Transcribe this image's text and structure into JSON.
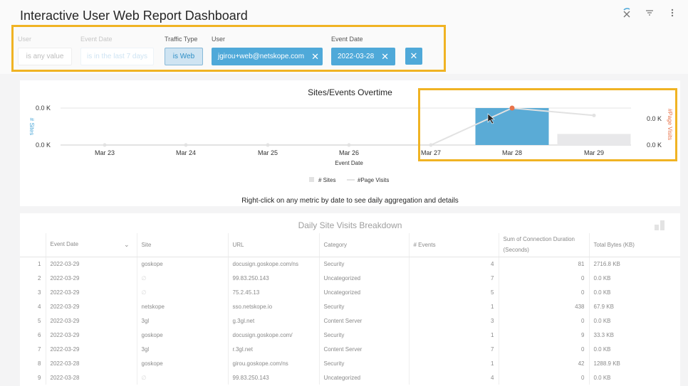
{
  "page": {
    "title": "Interactive User Web Report Dashboard"
  },
  "header_icons": [
    "loading-close-icon",
    "filter-icon",
    "more-vert-icon"
  ],
  "filters": [
    {
      "label": "User",
      "value": "is any value"
    },
    {
      "label": "Event Date",
      "value": "is in the last 7 days"
    },
    {
      "label": "Traffic Type",
      "value": "is Web"
    },
    {
      "label": "User",
      "value": "jgirou+web@netskope.com"
    },
    {
      "label": "Event Date",
      "value": "2022-03-28"
    }
  ],
  "chart": {
    "title": "Sites/Events Overtime",
    "hint": "Right-click on  any metric by date to see daily aggregation and details"
  },
  "chart_data": {
    "type": "bar",
    "title": "Sites/Events Overtime",
    "xlabel": "Event Date",
    "ylabel_left": "# Sites",
    "ylabel_right": "#Page Visits",
    "categories": [
      "Mar 23",
      "Mar 24",
      "Mar 25",
      "Mar 26",
      "Mar 27",
      "Mar 28",
      "Mar 29"
    ],
    "left_ticks": [
      "0.0 K",
      "0.0 K"
    ],
    "right_ticks": [
      "0.0 K",
      "0.0 K"
    ],
    "series": [
      {
        "name": "# Sites",
        "type": "bar",
        "values": [
          0,
          0,
          0,
          0,
          0,
          1.0,
          0.3
        ],
        "colors": [
          "#5aabd6",
          "#5aabd6",
          "#5aabd6",
          "#5aabd6",
          "#5aabd6",
          "#5aabd6",
          "#e8e8ea"
        ]
      },
      {
        "name": "#Page Visits",
        "type": "line",
        "values": [
          0,
          0,
          0,
          0,
          0,
          1.0,
          0.8
        ]
      }
    ],
    "legend": {
      "placement": "bottom"
    }
  },
  "table": {
    "title": "Daily Site Visits Breakdown",
    "columns": [
      "Event Date",
      "Site",
      "URL",
      "Category",
      "# Events",
      "Sum of Connection Duration (Seconds)",
      "Total Bytes (KB)"
    ],
    "rows": [
      {
        "idx": "1",
        "date": "2022-03-29",
        "site": "goskope",
        "url": "docusign.goskope.com/ns",
        "category": "Security",
        "events": "4",
        "duration": "81",
        "bytes": "2716.8 KB"
      },
      {
        "idx": "2",
        "date": "2022-03-29",
        "site": "∅",
        "url": "99.83.250.143",
        "category": "Uncategorized",
        "events": "7",
        "duration": "0",
        "bytes": "0.0 KB"
      },
      {
        "idx": "3",
        "date": "2022-03-29",
        "site": "∅",
        "url": "75.2.45.13",
        "category": "Uncategorized",
        "events": "5",
        "duration": "0",
        "bytes": "0.0 KB"
      },
      {
        "idx": "4",
        "date": "2022-03-29",
        "site": "netskope",
        "url": "sso.netskope.io",
        "category": "Security",
        "events": "1",
        "duration": "438",
        "bytes": "67.9 KB"
      },
      {
        "idx": "5",
        "date": "2022-03-29",
        "site": "3gl",
        "url": "g.3gl.net",
        "category": "Content Server",
        "events": "3",
        "duration": "0",
        "bytes": "0.0 KB"
      },
      {
        "idx": "6",
        "date": "2022-03-29",
        "site": "goskope",
        "url": "docusign.goskope.com/",
        "category": "Security",
        "events": "1",
        "duration": "9",
        "bytes": "33.3 KB"
      },
      {
        "idx": "7",
        "date": "2022-03-29",
        "site": "3gl",
        "url": "r.3gl.net",
        "category": "Content Server",
        "events": "7",
        "duration": "0",
        "bytes": "0.0 KB"
      },
      {
        "idx": "8",
        "date": "2022-03-28",
        "site": "goskope",
        "url": "girou.goskope.com/ns",
        "category": "Security",
        "events": "1",
        "duration": "42",
        "bytes": "1288.9 KB"
      },
      {
        "idx": "9",
        "date": "2022-03-28",
        "site": "∅",
        "url": "99.83.250.143",
        "category": "Uncategorized",
        "events": "4",
        "duration": "0",
        "bytes": "0.0 KB"
      }
    ]
  },
  "colors": {
    "accent": "#4fa9d9",
    "highlight": "#f0b323",
    "bar": "#5aabd6",
    "line_point": "#e8734a"
  }
}
